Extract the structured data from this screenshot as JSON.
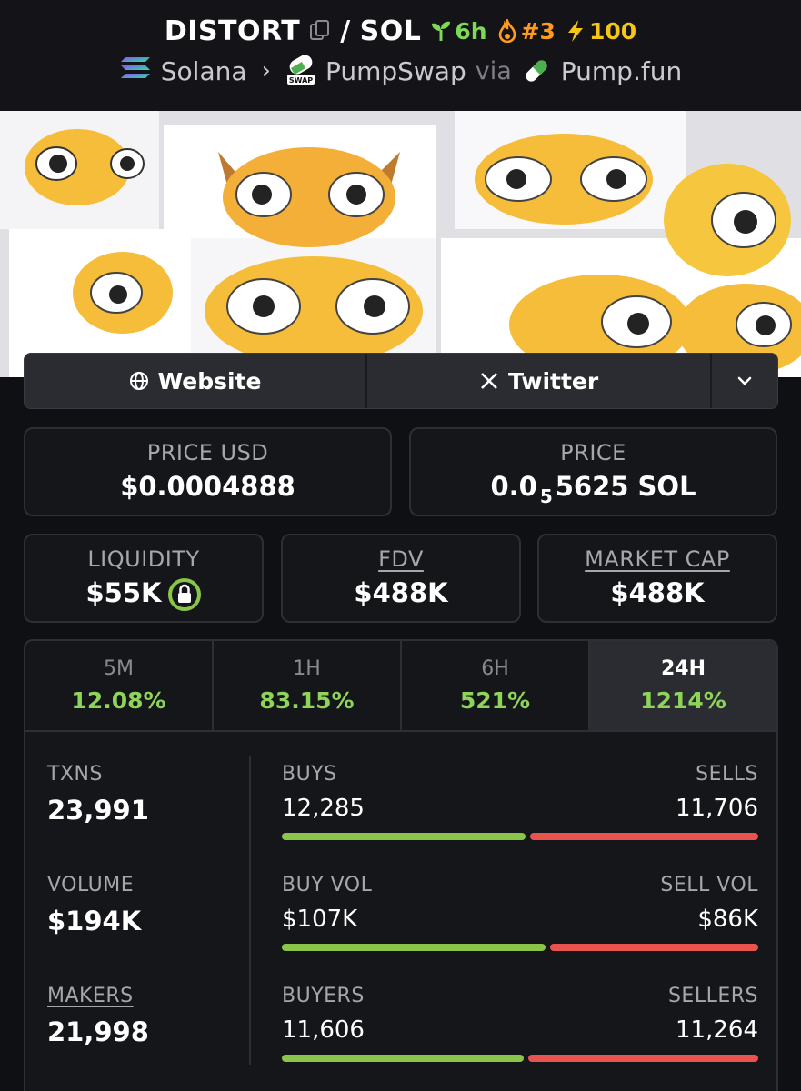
{
  "header": {
    "token": "DISTORT",
    "separator": "/",
    "quote": "SOL",
    "age": "6h",
    "rank": "#3",
    "boost": "100",
    "chain": "Solana",
    "dex": "PumpSwap",
    "via": "via",
    "launchpad": "Pump.fun",
    "swap_badge": "SWAP"
  },
  "links": {
    "website": "Website",
    "twitter": "Twitter"
  },
  "prices": {
    "price_usd_label": "PRICE USD",
    "price_usd": "$0.0004888",
    "price_label": "PRICE",
    "price_sol_prefix": "0.0",
    "price_sol_sub": "5",
    "price_sol_rest": "5625 SOL"
  },
  "stats": {
    "liquidity_label": "LIQUIDITY",
    "liquidity": "$55K",
    "fdv_label": "FDV",
    "fdv": "$488K",
    "mcap_label": "MARKET CAP",
    "mcap": "$488K"
  },
  "tabs": [
    {
      "label": "5M",
      "value": "12.08%"
    },
    {
      "label": "1H",
      "value": "83.15%"
    },
    {
      "label": "6H",
      "value": "521%"
    },
    {
      "label": "24H",
      "value": "1214%"
    }
  ],
  "txns": {
    "txns_label": "TXNS",
    "txns": "23,991",
    "volume_label": "VOLUME",
    "volume": "$194K",
    "makers_label": "MAKERS",
    "makers": "21,998",
    "buys_label": "BUYS",
    "buys": "12,285",
    "sells_label": "SELLS",
    "sells": "11,706",
    "buy_vol_label": "BUY VOL",
    "buy_vol": "$107K",
    "sell_vol_label": "SELL VOL",
    "sell_vol": "$86K",
    "buyers_label": "BUYERS",
    "buyers": "11,606",
    "sellers_label": "SELLERS",
    "sellers": "11,264",
    "buys_share": 0.512,
    "buy_vol_share": 0.554,
    "buyers_share": 0.507
  },
  "colors": {
    "positive": "#8fd45a",
    "buy_bar": "#8ac449",
    "sell_bar": "#e8534f",
    "rank": "#ff9c20",
    "boost": "#f5c518"
  }
}
